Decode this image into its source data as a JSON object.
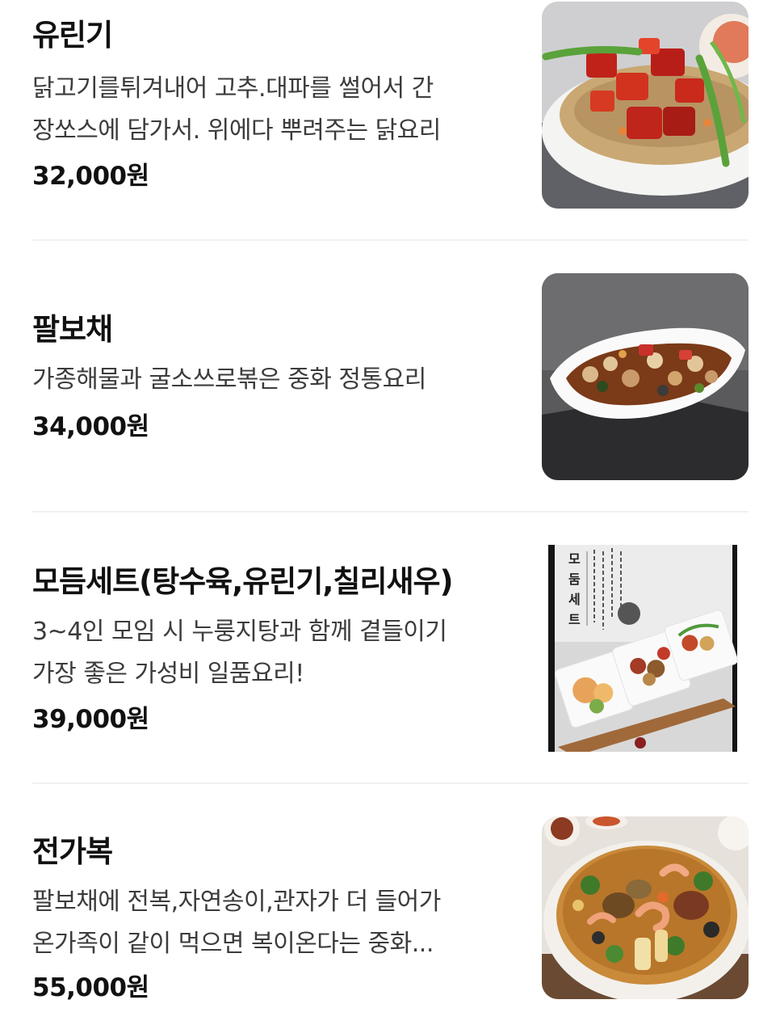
{
  "menu": {
    "items": [
      {
        "name": "유린기",
        "description_lines": [
          "닭고기를튀겨내어 고추.대파를 썰어서 간",
          "장쏘스에 담가서. 위에다 뿌려주는 닭요리"
        ],
        "price": "32,000원",
        "image_icon": "yuringi-photo"
      },
      {
        "name": "팔보채",
        "description_lines": [
          "가종해물과 굴소쓰로볶은 중화 정통요리"
        ],
        "price": "34,000원",
        "image_icon": "palbochae-photo"
      },
      {
        "name": "모듬세트(탕수육,유린기,칠리새우)",
        "description_lines": [
          "3~4인 모임 시 누룽지탕과 함께 곁들이기",
          "가장 좋은 가성비 일품요리!"
        ],
        "price": "39,000원",
        "image_icon": "modeum-set-photo",
        "image_text": {
          "title": "모둠세트"
        }
      },
      {
        "name": "전가복",
        "description_lines": [
          "팔보채에 전복,자연송이,관자가 더 들어가",
          "온가족이 같이 먹으면 복이온다는 중화..."
        ],
        "price": "55,000원",
        "image_icon": "jeongabok-photo"
      }
    ]
  }
}
